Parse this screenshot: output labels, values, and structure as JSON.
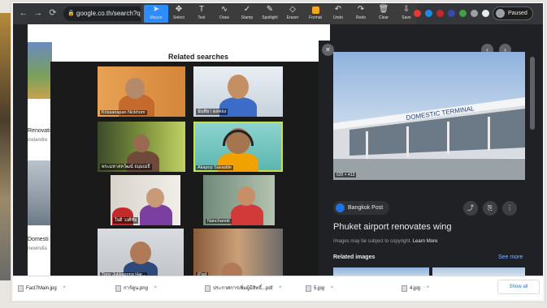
{
  "browser": {
    "url": "google.co.th/search?q",
    "back_icon": "arrow-left-icon",
    "forward_icon": "arrow-right-icon",
    "reload_icon": "reload-icon"
  },
  "zoom_toolbar": {
    "tools": [
      {
        "label": "Mouse",
        "icon": "cursor-icon",
        "active": true
      },
      {
        "label": "Select",
        "icon": "select-icon"
      },
      {
        "label": "Text",
        "icon": "text-icon"
      },
      {
        "label": "Draw",
        "icon": "draw-icon"
      },
      {
        "label": "Stamp",
        "icon": "stamp-icon"
      },
      {
        "label": "Spotlight",
        "icon": "spotlight-icon"
      },
      {
        "label": "Eraser",
        "icon": "eraser-icon"
      },
      {
        "label": "Format",
        "icon": "format-icon"
      },
      {
        "label": "Undo",
        "icon": "undo-icon"
      },
      {
        "label": "Redo",
        "icon": "redo-icon"
      },
      {
        "label": "Clear",
        "icon": "trash-icon"
      },
      {
        "label": "Save",
        "icon": "save-icon"
      }
    ],
    "paused_label": "Paused",
    "format_color": "#f5a623",
    "accent": "#2d8cff"
  },
  "google": {
    "related_searches": "Related searches",
    "result_labels": [
      "Renovati",
      "icelandre",
      "Domesti",
      "newindia"
    ]
  },
  "participants": [
    {
      "name": "Krissanapan Nickhom"
    },
    {
      "name": "นันทิยา ผลทอง"
    },
    {
      "name": "พระมหาสหวัฒน์ ธมฺมเมธี"
    },
    {
      "name": "Akapop Savadde",
      "speaking": true
    },
    {
      "name": "ใจดี วงศ์ชัย"
    },
    {
      "name": "Nanchanok"
    },
    {
      "name": "Tony Jukkapong Har..."
    },
    {
      "name": "iPad"
    }
  ],
  "viewer": {
    "size_badge": "620 × 413",
    "terminal_sign": "DOMESTIC TERMINAL",
    "source": "Bangkok Post",
    "title": "Phuket airport renovates wing",
    "copyright": "Images may be subject to copyright.",
    "learn_more": "Learn More",
    "related_images": "Related images",
    "see_more": "See more"
  },
  "downloads": {
    "items": [
      {
        "name": "Fact7Main.jpg"
      },
      {
        "name": "การ์ตูน.png"
      },
      {
        "name": "ประกาศการเพิ่มผู้มีสิทธิ์...pdf"
      },
      {
        "name": "5.jpg"
      },
      {
        "name": "4.jpg"
      }
    ],
    "show_all": "Show all"
  }
}
